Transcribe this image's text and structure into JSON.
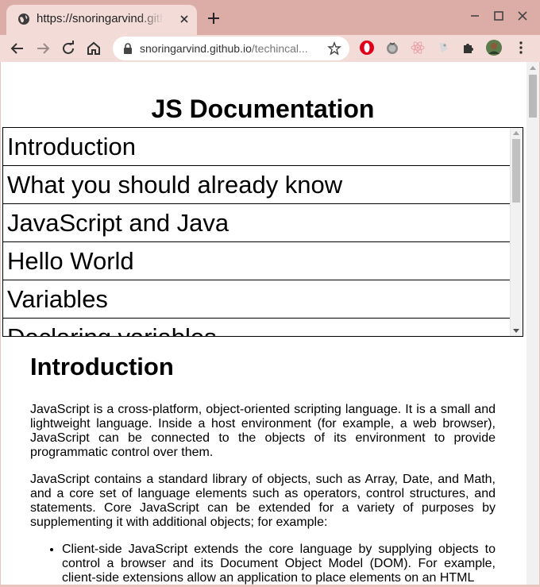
{
  "browser": {
    "tab": {
      "title": "https://snoringarvind.github.io/techincal-documentation-page/"
    },
    "address": {
      "host": "snoringarvind.github.io",
      "path": "/techincal..."
    }
  },
  "page": {
    "title": "JS Documentation",
    "nav_links": [
      "Introduction",
      "What you should already know",
      "JavaScript and Java",
      "Hello World",
      "Variables",
      "Declaring variables"
    ],
    "section": {
      "heading": "Introduction",
      "paragraphs": [
        "JavaScript is a cross-platform, object-oriented scripting language. It is a small and lightweight language. Inside a host environment (for example, a web browser), JavaScript can be connected to the objects of its environment to provide programmatic control over them.",
        "JavaScript contains a standard library of objects, such as Array, Date, and Math, and a core set of language elements such as operators, control structures, and statements. Core JavaScript can be extended for a variety of purposes by supplementing it with additional objects; for example:"
      ],
      "list": [
        "Client-side JavaScript extends the core language by supplying objects to control a browser and its Document Object Model (DOM). For example, client-side extensions allow an application to place elements on an HTML"
      ]
    }
  }
}
